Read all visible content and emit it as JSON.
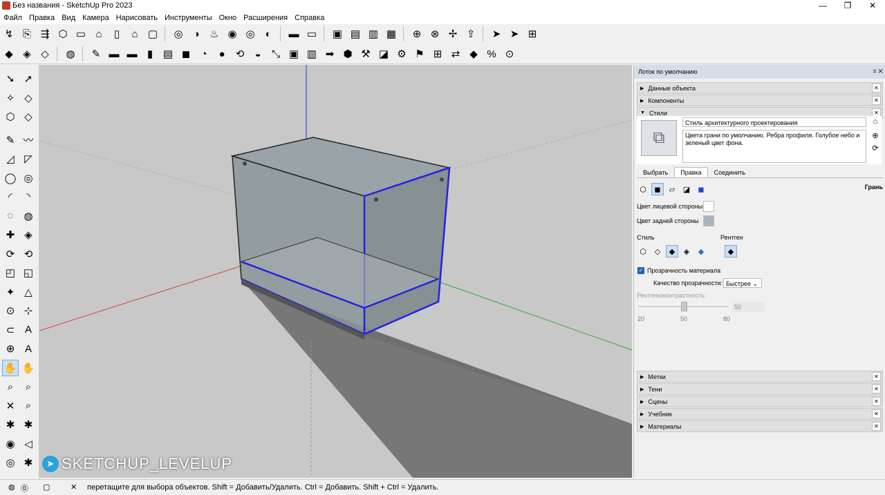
{
  "window": {
    "title": "Без названия - SketchUp Pro 2023",
    "minimize": "—",
    "maximize": "❐",
    "close": "✕"
  },
  "menu": [
    "Файл",
    "Правка",
    "Вид",
    "Камера",
    "Нарисовать",
    "Инструменты",
    "Окно",
    "Расширения",
    "Справка"
  ],
  "toolbar1": [
    "↯",
    "⎘",
    "⇶",
    "⬡",
    "▭",
    "⌂",
    "▯",
    "⌂",
    "▢",
    "|",
    "◎",
    "◑",
    "♨",
    "◉",
    "◎",
    "◐",
    "|",
    "▬",
    "▭",
    "|",
    "▣",
    "▤",
    "▥",
    "▦",
    "|",
    "⊕",
    "⊗",
    "✢",
    "⇪",
    "|",
    "➤",
    "➤",
    "⊞"
  ],
  "toolbar2": [
    "◆",
    "◈",
    "◇",
    "|",
    "◍",
    "|",
    "✎",
    "▬",
    "▬",
    "▮",
    "▤",
    "◼",
    "◔",
    "●",
    "⟲",
    "◒",
    "⤡",
    "▣",
    "▥",
    "➡",
    "⬢",
    "⚒",
    "◪",
    "⚙",
    "⚑",
    "⊞",
    "⇄",
    "◆",
    "%",
    "⊙"
  ],
  "left_tools": [
    "➘",
    "➚",
    "✧",
    "◇",
    "⬡",
    "◇",
    "✎",
    "〰",
    "◿",
    "◸",
    "◯",
    "◎",
    "◜",
    "◝",
    "◌",
    "◍",
    "✚",
    "◈",
    "⟳",
    "⟲",
    "◰",
    "◱",
    "✦",
    "△",
    "⊙",
    "⊹",
    "⊂",
    "A",
    "⊕",
    "A",
    "✋",
    "✋",
    "⌕",
    "⌕",
    "✕",
    "⌕",
    "✱",
    "✱",
    "◉",
    "◁",
    "◎",
    "✱"
  ],
  "watermark": "SKETCHUP_LEVELUP",
  "tray": {
    "title": "Лоток по умолчанию",
    "sections_top": [
      "Данные объекта",
      "Компоненты",
      "Стили"
    ],
    "style_name": "Стиль архитектурного проектирования",
    "style_desc": "Цвета грани по умолчанию. Ребра профиля. Голубое небо и зеленый цвет фона.",
    "tabs": [
      "Выбрать",
      "Правка",
      "Соединить"
    ],
    "edit_label": "Грань",
    "front_color_label": "Цвет лицевой стороны",
    "back_color_label": "Цвет задней стороны",
    "style_label": "Стиль",
    "xray_label": "Рентген",
    "transparency_label": "Прозрачность материала",
    "quality_label": "Качество прозрачности:",
    "quality_value": "Быстрее",
    "xray_contrast_label": "Рентгеноконтрастность:",
    "xray_contrast_value": "50",
    "slider_ticks": [
      "20",
      "50",
      "80"
    ],
    "sections_bottom": [
      "Метки",
      "Тени",
      "Сцены",
      "Учебник",
      "Материалы"
    ],
    "colors": {
      "front": "#ffffff",
      "back": "#a9b3bd"
    }
  },
  "status": {
    "message": "перетащите для выбора объектов. Shift = Добавить/Удалить. Ctrl = Добавить. Shift + Ctrl = Удалить."
  }
}
